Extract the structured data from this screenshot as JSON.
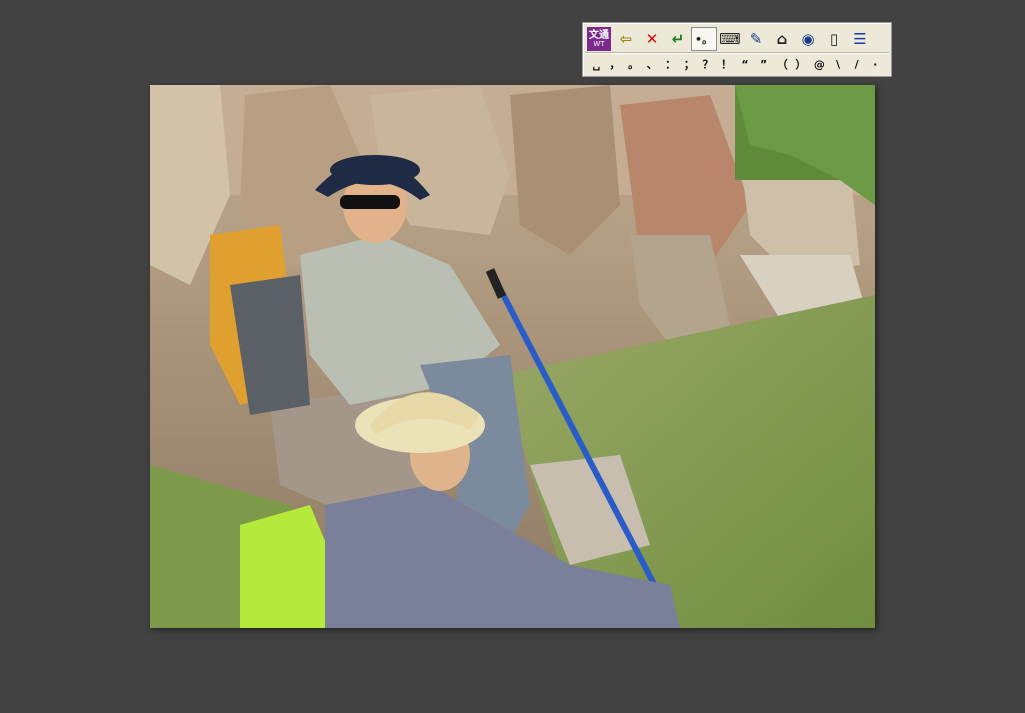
{
  "ime_toolbar": {
    "logo": {
      "line1": "文通",
      "line2": "WT"
    },
    "tools": [
      {
        "name": "back-arrow-icon",
        "glyph": "⇦",
        "color": "#9a8a10"
      },
      {
        "name": "close-icon",
        "glyph": "✕",
        "color": "#d01010"
      },
      {
        "name": "enter-icon",
        "glyph": "↵",
        "color": "#1a7a1a"
      },
      {
        "name": "punctuation-mode-icon",
        "glyph": "•。",
        "color": "#222222"
      },
      {
        "name": "keyboard-icon",
        "glyph": "⌨",
        "color": "#222222"
      },
      {
        "name": "edit-icon",
        "glyph": "✎",
        "color": "#1a3a8a"
      },
      {
        "name": "eraser-icon",
        "glyph": "⌂",
        "color": "#222222"
      },
      {
        "name": "eye-icon",
        "glyph": "◉",
        "color": "#1a3a8a"
      },
      {
        "name": "mouse-icon",
        "glyph": "▯",
        "color": "#222222"
      },
      {
        "name": "menu-icon",
        "glyph": "☰",
        "color": "#1a3aaa"
      }
    ],
    "punctuation": [
      "␣",
      "，",
      "。",
      "、",
      "：",
      "；",
      "？",
      "！",
      "“",
      "”",
      "（",
      "）",
      "@",
      "\\",
      "/",
      "·"
    ]
  },
  "photo": {
    "description_alt": "photo",
    "colors": {
      "rock": "#b39a7e",
      "grass": "#7d9a4a",
      "sky_tree": "#5f8a3a"
    }
  }
}
